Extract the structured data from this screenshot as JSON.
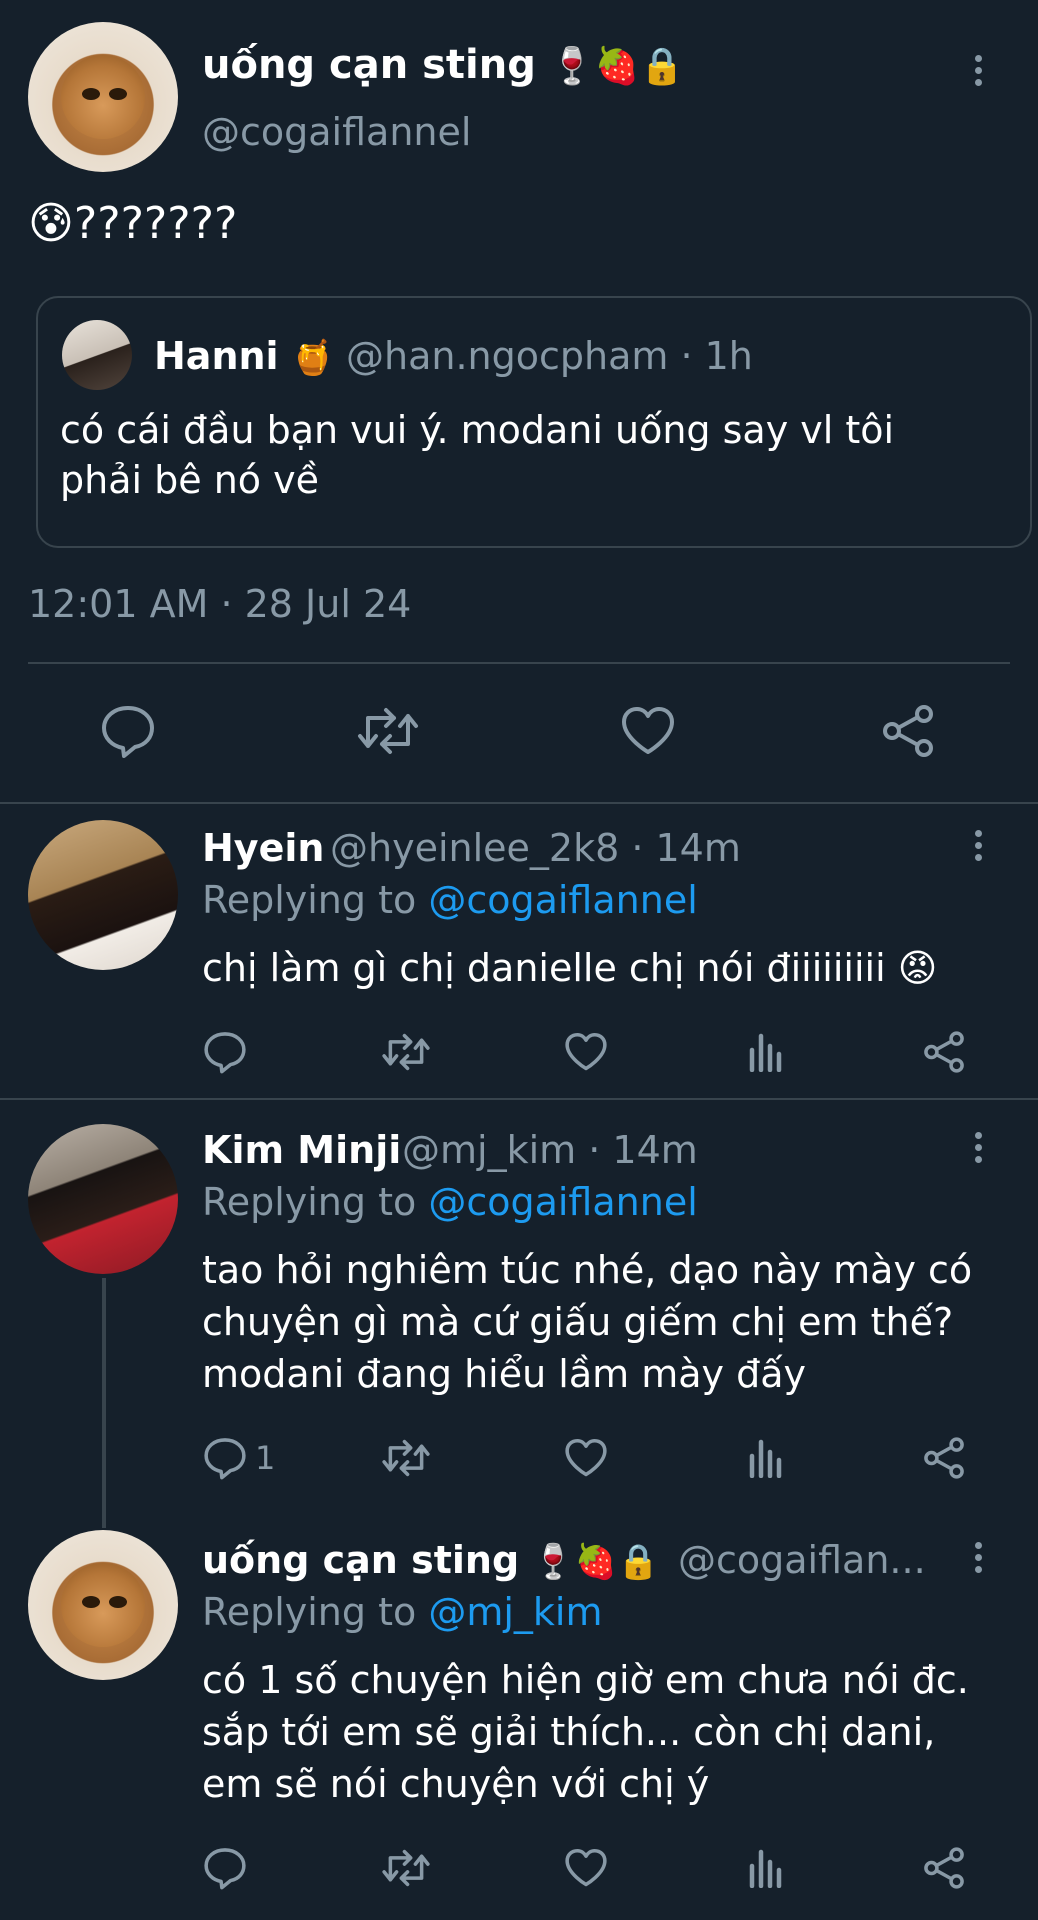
{
  "main_tweet": {
    "name": "uống cạn sting",
    "badges": "🍷🍓🔒",
    "handle": "@cogaiflannel",
    "text": "😰???????",
    "timestamp": "12:01 AM · 28 Jul 24",
    "quoted": {
      "name": "Hanni",
      "badge": "🍯",
      "handle_time": "@han.ngocpham · 1h",
      "text_line1": "có cái đầu bạn vui ý. modani uống say vl tôi",
      "text_line2": "phải bê nó về"
    },
    "actions": [
      "reply-icon",
      "retweet-icon",
      "like-icon",
      "share-icon"
    ]
  },
  "replies": [
    {
      "name": "Hyein",
      "handle_time": "@hyeinlee_2k8 · 14m",
      "replying_prefix": "Replying to",
      "replying_to": "@cogaiflannel",
      "text_line1": "chị làm gì chị danielle chị nói điiiiiiiii 😡",
      "reply_count": ""
    },
    {
      "name": "Kim Minji",
      "handle_time": "@mj_kim · 14m",
      "replying_prefix": "Replying to",
      "replying_to": "@cogaiflannel",
      "text_line1": "tao hỏi nghiêm túc nhé, dạo này mày có",
      "text_line2": "chuyện gì mà cứ giấu giếm chị em thế?",
      "text_line3": "modani đang hiểu lầm mày đấy",
      "reply_count": "1"
    },
    {
      "name": "uống cạn sting",
      "badges": "🍷🍓🔒",
      "handle_time": "@cogaiflan...",
      "replying_prefix": "Replying to",
      "replying_to": "@mj_kim",
      "text_line1": "có 1 số chuyện hiện giờ em chưa nói đc.",
      "text_line2": "sắp tới em sẽ giải thích... còn chị dani,",
      "text_line3": "em sẽ nói chuyện với chị ý",
      "reply_count": ""
    }
  ],
  "colors": {
    "background": "#15202b",
    "text": "#ffffff",
    "muted": "#8899a6",
    "link": "#1d9bf0",
    "divider": "#38444d"
  }
}
